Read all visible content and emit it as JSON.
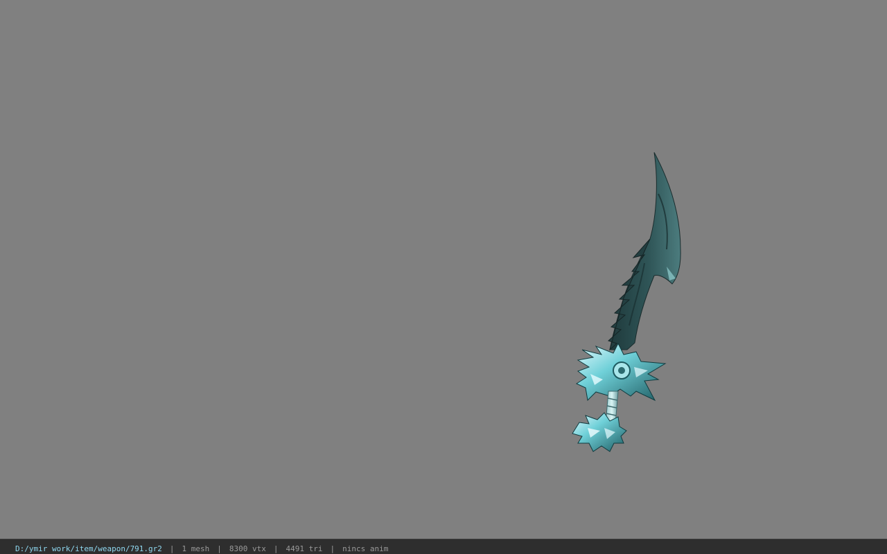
{
  "viewport": {
    "background_color": "#808080",
    "model_name": "sword-model"
  },
  "statusbar": {
    "path": "D:/ymir work/item/weapon/791.gr2",
    "separator": "|",
    "mesh": "1 mesh",
    "vertices": "8300 vtx",
    "triangles": "4491 tri",
    "anim": "nincs anim",
    "path_color": "#8fd8f0"
  }
}
